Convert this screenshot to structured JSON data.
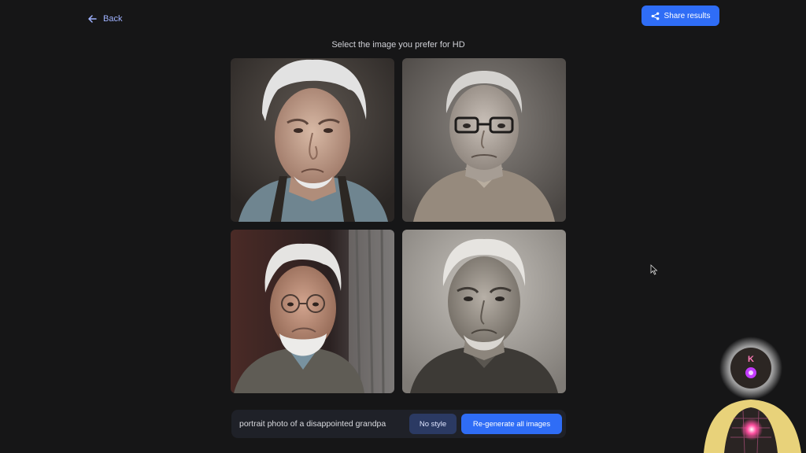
{
  "nav": {
    "back_label": "Back"
  },
  "header": {
    "share_label": "Share results"
  },
  "main": {
    "heading": "Select the image you prefer for HD",
    "images": [
      {
        "name": "portrait-1"
      },
      {
        "name": "portrait-2"
      },
      {
        "name": "portrait-3"
      },
      {
        "name": "portrait-4"
      }
    ]
  },
  "prompt": {
    "text": "portrait photo of a disappointed grandpa",
    "style_label": "No style",
    "regenerate_label": "Re-generate all images"
  },
  "overlay": {
    "mascot_letter": "K"
  },
  "colors": {
    "accent": "#2f6df6",
    "background": "#161617",
    "secondary_button": "#2b3a63"
  }
}
